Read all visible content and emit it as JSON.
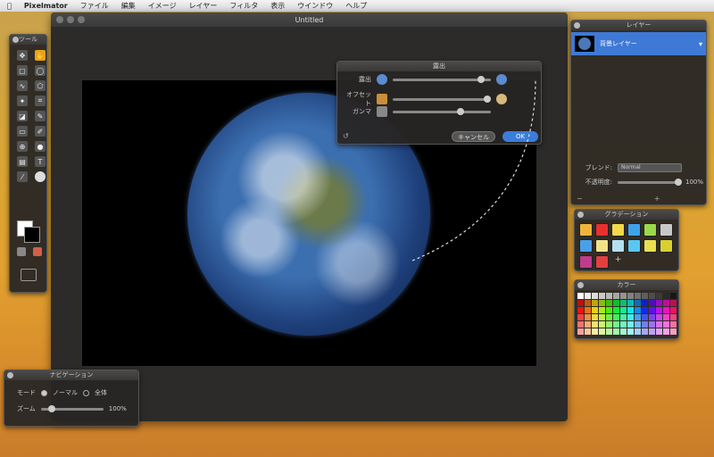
{
  "menubar": {
    "apple": "",
    "app_name": "Pixelmator",
    "items": [
      "ファイル",
      "編集",
      "イメージ",
      "レイヤー",
      "フィルタ",
      "表示",
      "ウインドウ",
      "ヘルプ"
    ]
  },
  "window": {
    "title": "Untitled"
  },
  "tools_panel": {
    "title": "ツール"
  },
  "adjust_dialog": {
    "title": "露出",
    "rows": [
      {
        "label": "露出",
        "value": ""
      },
      {
        "label": "オフセット",
        "value": ""
      },
      {
        "label": "ガンマ",
        "value": ""
      }
    ],
    "cancel_label": "キャンセル",
    "ok_label": "OK"
  },
  "layers_panel": {
    "title": "レイヤー",
    "layer_name": "背景レイヤー",
    "blend_label": "ブレンド:",
    "blend_value": "Normal",
    "opacity_label": "不透明度:",
    "opacity_value": "100%",
    "add_symbol": "+",
    "remove_symbol": "−",
    "gear_symbol": "✱"
  },
  "gradients_panel": {
    "title": "グラデーション",
    "swatches": [
      "#f0b43c",
      "#e83030",
      "#f2d84a",
      "#3fa2e8",
      "#9bd84a",
      "#c8c8c8",
      "#4aa0e8",
      "#f0e28a",
      "#b4e0f0",
      "#5bc6f0",
      "#e8e050",
      "#d8d030",
      "#c03c8c",
      "#e04040"
    ],
    "add_symbol": "+"
  },
  "colors_panel": {
    "title": "カラー"
  },
  "navigator_panel": {
    "title": "ナビゲーション",
    "mode_label": "モード",
    "option_normal": "ノーマル",
    "option_fit": "全体",
    "zoom_label": "ズーム",
    "zoom_value": "100%"
  }
}
